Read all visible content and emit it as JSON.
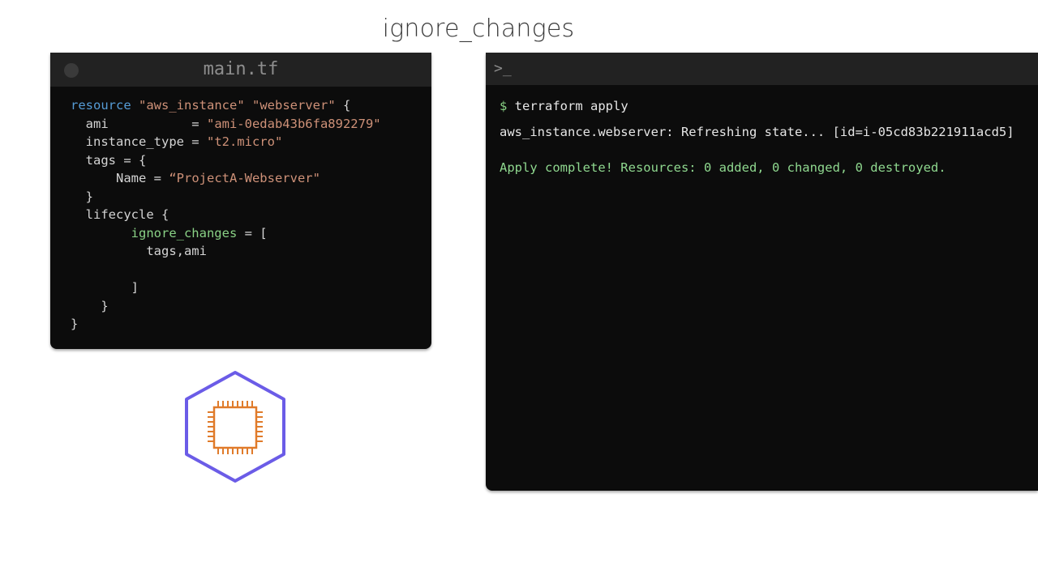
{
  "slide": {
    "title": "ignore_changes"
  },
  "editor": {
    "filename": "main.tf",
    "code": {
      "l1_kw": "resource",
      "l1_s1": "\"aws_instance\"",
      "l1_s2": "\"webserver\"",
      "l1_end": " {",
      "l2_key": "  ami           = ",
      "l2_val": "\"ami-0edab43b6fa892279\"",
      "l3_key": "  instance_type = ",
      "l3_val": "\"t2.micro\"",
      "l4": "  tags = {",
      "l5_key": "      Name = ",
      "l5_val": "“ProjectA-Webserver\"",
      "l6": "  }",
      "l7": "  lifecycle {",
      "l8_indent": "        ",
      "l8_attr": "ignore_changes",
      "l8_end": " = [",
      "l9": "          tags,ami",
      "l10": "",
      "l11": "        ]",
      "l12": "    }",
      "l13": "}"
    }
  },
  "terminal": {
    "prompt_icon": ">_",
    "dollar": "$",
    "command": " terraform apply",
    "refresh_line": "aws_instance.webserver: Refreshing state... [id=i-05cd83b221911acd5]",
    "complete_line": "Apply complete! Resources: 0 added, 0 changed, 0 destroyed."
  },
  "icons": {
    "ec2": "ec2-instance-chip-icon"
  },
  "colors": {
    "hexagon_stroke": "#6b5ce7",
    "chip_stroke": "#e07b2a",
    "success_green": "#8fd88f",
    "keyword_blue": "#569cd6",
    "string_orange": "#ce9178"
  }
}
